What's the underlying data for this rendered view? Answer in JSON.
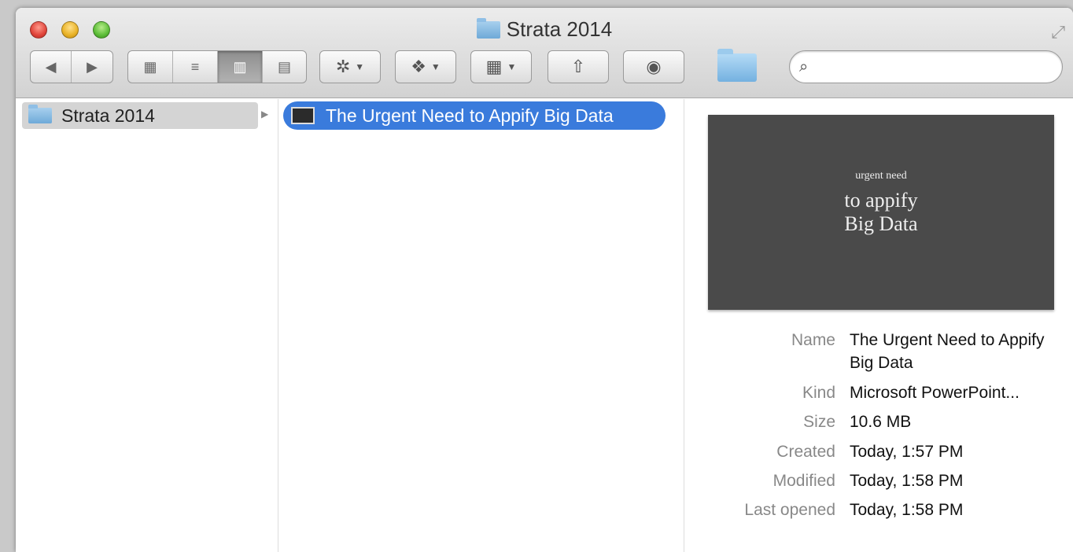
{
  "window": {
    "title": "Strata 2014"
  },
  "toolbar": {
    "back": "◀",
    "forward": "▶",
    "view_icons": "▦",
    "view_list": "≡",
    "view_columns": "▥",
    "view_coverflow": "▤",
    "action": "✲",
    "dropbox": "❖",
    "arrange": "▦",
    "share": "⇧",
    "tags": "◉"
  },
  "search": {
    "placeholder": ""
  },
  "columns": {
    "col1_item": "Strata 2014",
    "col2_item": "The Urgent Need to Appify Big Data"
  },
  "preview": {
    "line1": "urgent need",
    "line2": "to appify",
    "line3": "Big Data"
  },
  "info": {
    "name_label": "Name",
    "name_value": "The Urgent Need to Appify Big Data",
    "kind_label": "Kind",
    "kind_value": "Microsoft PowerPoint...",
    "size_label": "Size",
    "size_value": "10.6 MB",
    "created_label": "Created",
    "created_value": "Today, 1:57 PM",
    "modified_label": "Modified",
    "modified_value": "Today, 1:58 PM",
    "opened_label": "Last opened",
    "opened_value": "Today, 1:58 PM"
  },
  "colors": {
    "selection": "#3a7bdc"
  }
}
